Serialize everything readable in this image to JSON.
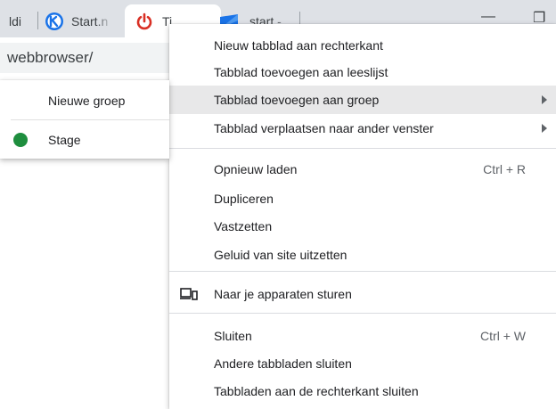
{
  "tabs": [
    {
      "title": "ldi",
      "icon": "tab-favicon"
    },
    {
      "title": "Start.n",
      "icon": "k-logo-icon"
    },
    {
      "title": "Ti",
      "icon": "power-icon"
    },
    {
      "title": "start -",
      "icon": "blue-flag-icon"
    }
  ],
  "window_controls": {
    "minimize": "—",
    "restore": "❐"
  },
  "omnibox": {
    "text": "webbrowser/"
  },
  "submenu": {
    "new_group": "Nieuwe groep",
    "groups": [
      {
        "name": "Stage",
        "color": "#1e8e3e"
      }
    ]
  },
  "menu": {
    "new_tab_right": "Nieuw tabblad aan rechterkant",
    "add_reading_list": "Tabblad toevoegen aan leeslijst",
    "add_to_group": "Tabblad toevoegen aan groep",
    "move_to_window": "Tabblad verplaatsen naar ander venster",
    "reload": "Opnieuw laden",
    "reload_shortcut": "Ctrl + R",
    "duplicate": "Dupliceren",
    "pin": "Vastzetten",
    "mute": "Geluid van site uitzetten",
    "send_devices": "Naar je apparaten sturen",
    "close": "Sluiten",
    "close_shortcut": "Ctrl + W",
    "close_others": "Andere tabbladen sluiten",
    "close_right": "Tabbladen aan de rechterkant sluiten"
  },
  "colors": {
    "highlight": "#e8e8e9",
    "power_red": "#d93025",
    "k_blue": "#1a73e8",
    "group_green": "#1e8e3e"
  }
}
